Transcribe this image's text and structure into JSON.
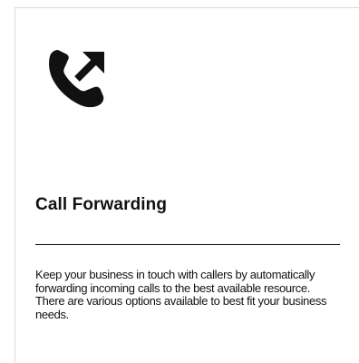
{
  "card": {
    "icon": "call-forwarding-icon",
    "title": "Call Forwarding",
    "description": "Keep your business in touch with callers by automatically forwarding incoming calls to the best available resource. There are various options available to best fit your business needs."
  },
  "colors": {
    "text": "#111111",
    "border": "#d9d9d9",
    "background": "#ffffff"
  }
}
